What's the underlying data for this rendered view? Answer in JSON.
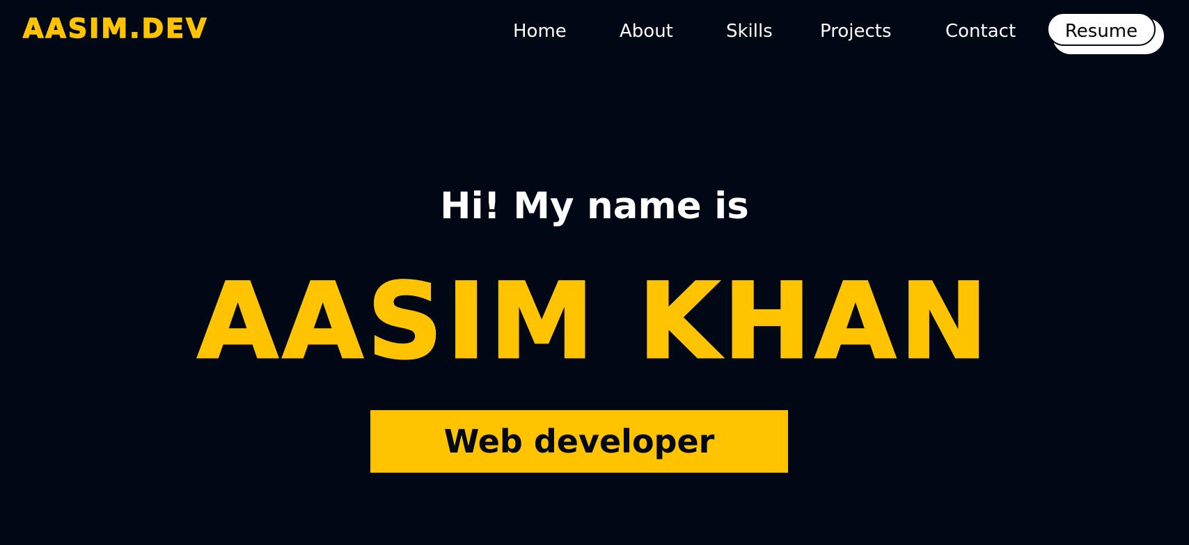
{
  "brand": {
    "logo_text": "AASIM.DEV"
  },
  "nav": {
    "items": [
      {
        "label": "Home"
      },
      {
        "label": "About"
      },
      {
        "label": "Skills"
      },
      {
        "label": "Projects"
      },
      {
        "label": "Contact"
      }
    ],
    "resume_label": "Resume"
  },
  "hero": {
    "greeting": "Hi! My name is",
    "name": "AASIM KHAN",
    "role": "Web developer"
  },
  "colors": {
    "background": "#010815",
    "accent": "#ffc300",
    "text": "#ffffff"
  }
}
